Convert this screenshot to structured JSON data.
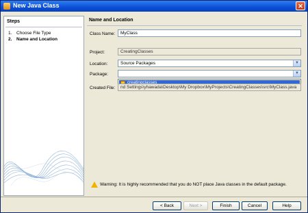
{
  "window": {
    "title": "New Java Class",
    "close_glyph": "✕"
  },
  "steps": {
    "heading": "Steps",
    "items": [
      {
        "num": "1.",
        "label": "Choose File Type"
      },
      {
        "num": "2.",
        "label": "Name and Location"
      }
    ]
  },
  "main": {
    "heading": "Name and Location",
    "class_name": {
      "label": "Class Name:",
      "value": "MyClass"
    },
    "project": {
      "label": "Project:",
      "value": "CreatingClasses"
    },
    "location": {
      "label": "Location:",
      "value": "Source Packages"
    },
    "package": {
      "label": "Package:",
      "value": ""
    },
    "package_dropdown": {
      "items": [
        "creatingclasses"
      ]
    },
    "created_file": {
      "label": "Created File:",
      "value": "nd Settings\\yhawada\\Desktop\\My Dropbox\\MyProjects\\CreatingClasses\\src\\MyClass.java"
    },
    "warning": "Warning: It is highly recommended that you do NOT place Java classes in the default package."
  },
  "buttons": {
    "back": "< Back",
    "next": "Next >",
    "finish": "Finish",
    "cancel": "Cancel",
    "help": "Help"
  },
  "icons": {
    "app": "java-class-icon",
    "close": "close-icon",
    "combo": "chevron-down-icon",
    "package": "package-icon",
    "warning": "warning-icon"
  }
}
